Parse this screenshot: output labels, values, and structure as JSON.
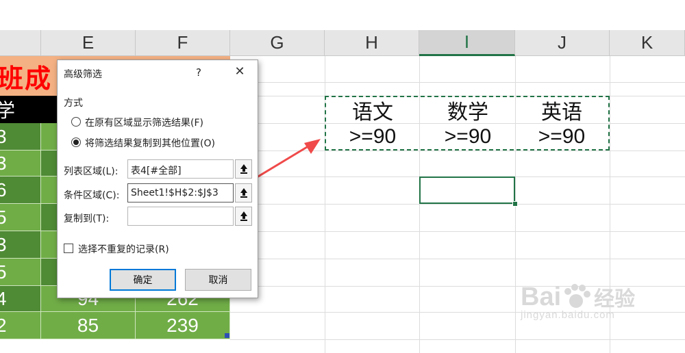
{
  "columns": [
    {
      "label": "",
      "selected": false
    },
    {
      "label": "E",
      "selected": false
    },
    {
      "label": "F",
      "selected": false
    },
    {
      "label": "G",
      "selected": false
    },
    {
      "label": "H",
      "selected": false
    },
    {
      "label": "I",
      "selected": true
    },
    {
      "label": "J",
      "selected": false
    },
    {
      "label": "K",
      "selected": false
    }
  ],
  "sheet": {
    "title_fragment": "班成",
    "header_fragment": "学",
    "rows_d": [
      "3",
      "3",
      "6",
      "5",
      "3",
      "5",
      "4",
      "2"
    ],
    "row_e_last": [
      "94",
      "85"
    ],
    "row_f_last": [
      "262",
      "239"
    ],
    "criteria": {
      "headers": [
        "语文",
        "数学",
        "英语"
      ],
      "values": [
        ">=90",
        ">=90",
        ">=90"
      ]
    }
  },
  "dialog": {
    "title": "高级筛选",
    "help": "?",
    "close": "✕",
    "group_label": "方式",
    "radio_1": "在原有区域显示筛选结果(F)",
    "radio_2": "将筛选结果复制到其他位置(O)",
    "list_range_label": "列表区域(L):",
    "list_range_value": "表4[#全部]",
    "criteria_range_label": "条件区域(C):",
    "criteria_range_value": "Sheet1!$H$2:$J$3",
    "copy_to_label": "复制到(T):",
    "copy_to_value": "",
    "unique_label": "选择不重复的记录(R)",
    "ok": "确定",
    "cancel": "取消"
  },
  "watermark": {
    "brand": "Bai",
    "brand2": "经验",
    "url": "jingyan.baidu.com"
  },
  "colors": {
    "green_dark": "#4f8a35",
    "green_light": "#70ad47",
    "title_red": "#ff0000",
    "title_bg": "#f4b183",
    "accent": "#217346",
    "arrow": "#f04a4a"
  }
}
